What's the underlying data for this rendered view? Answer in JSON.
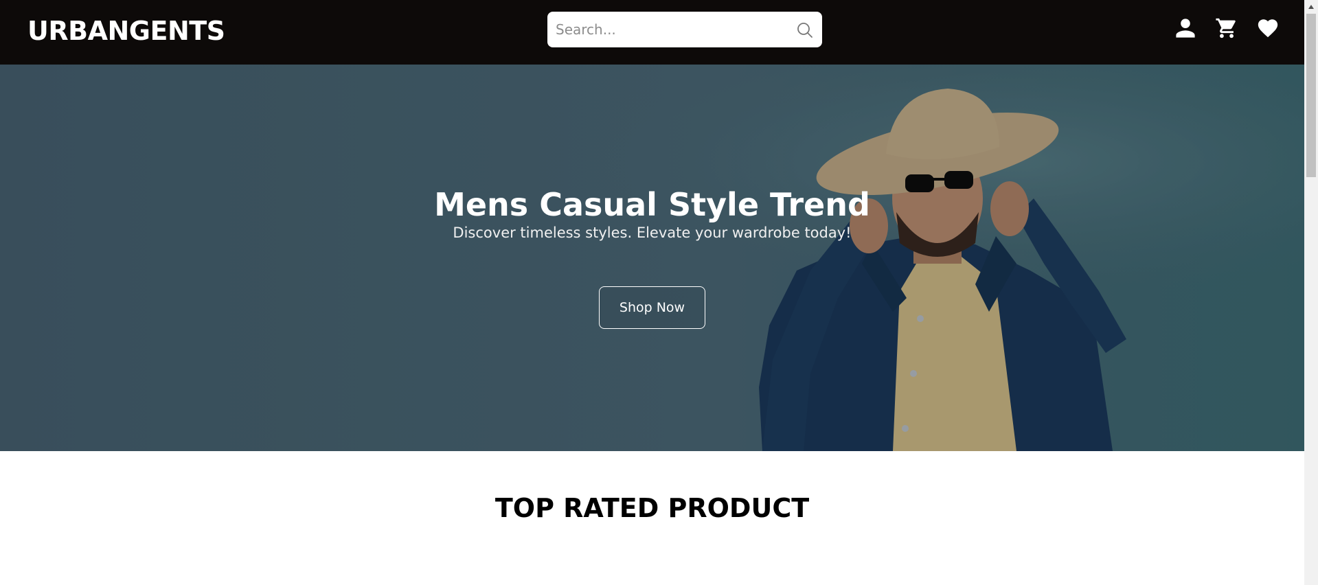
{
  "header": {
    "brand": "URBANGENTS",
    "search_placeholder": "Search...",
    "icons": [
      "user-icon",
      "cart-icon",
      "heart-icon"
    ]
  },
  "hero": {
    "title": "Mens Casual Style Trend",
    "subtitle": "Discover timeless styles. Elevate your wardrobe today!",
    "cta_label": "Shop Now"
  },
  "sections": {
    "top_rated_title": "TOP RATED PRODUCT"
  },
  "colors": {
    "header_bg": "#0d0a09",
    "hero_overlay": "#4c6977",
    "text_light": "#ffffff",
    "text_dark": "#000000"
  }
}
